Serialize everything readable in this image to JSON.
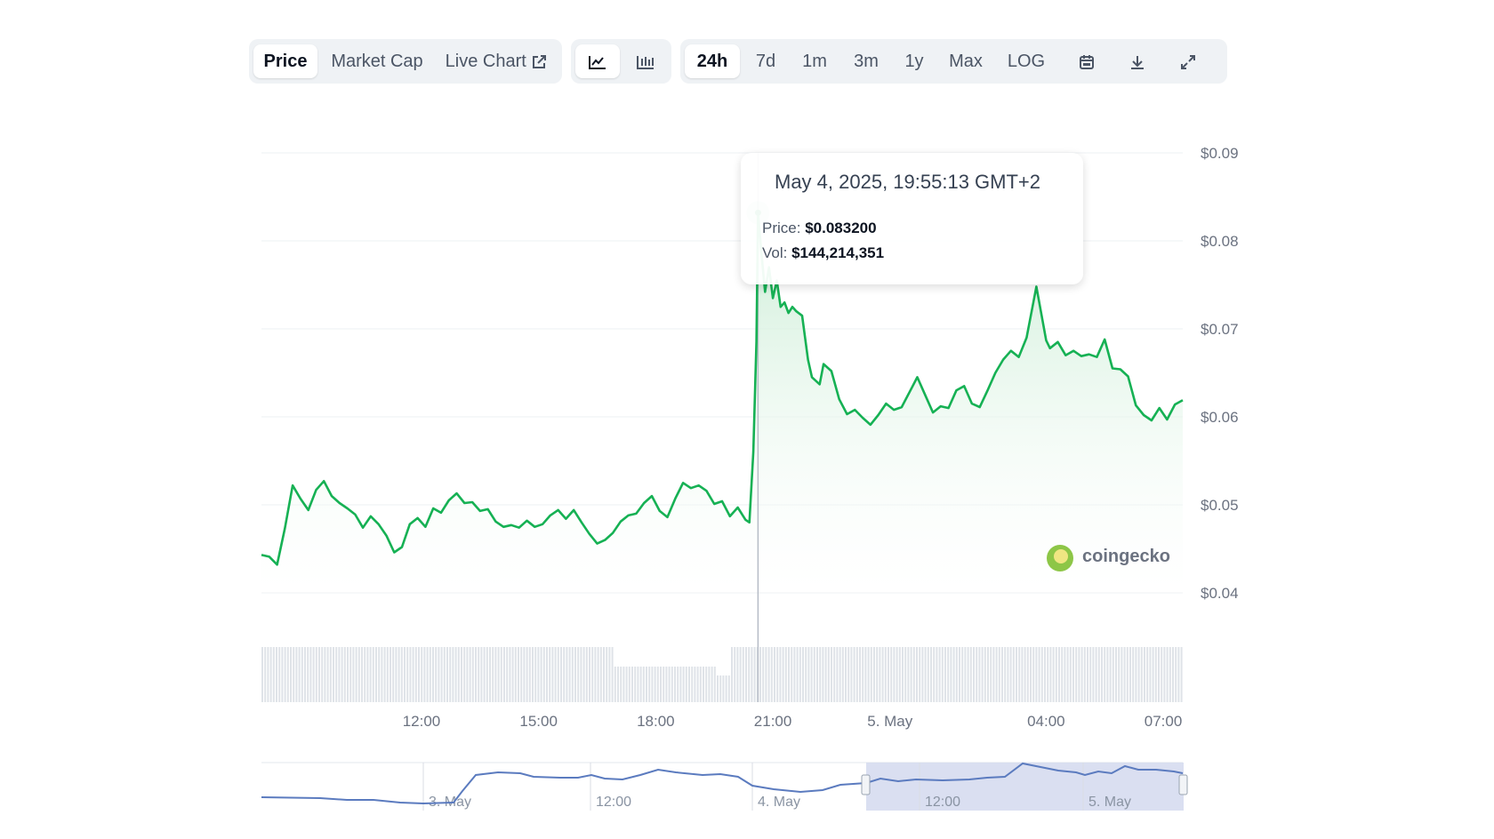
{
  "toolbar": {
    "views": [
      {
        "label": "Price",
        "active": true
      },
      {
        "label": "Market Cap",
        "active": false
      },
      {
        "label": "Live Chart",
        "active": false
      }
    ],
    "chart_types": [
      "line-chart-icon",
      "candlestick-chart-icon"
    ],
    "ranges": [
      {
        "label": "24h",
        "active": true
      },
      {
        "label": "7d",
        "active": false
      },
      {
        "label": "1m",
        "active": false
      },
      {
        "label": "3m",
        "active": false
      },
      {
        "label": "1y",
        "active": false
      },
      {
        "label": "Max",
        "active": false
      },
      {
        "label": "LOG",
        "active": false
      }
    ],
    "tools": [
      "calendar-icon",
      "download-icon",
      "fullscreen-icon"
    ]
  },
  "tooltip": {
    "date": "May 4, 2025, 19:55:13 GMT+2",
    "price_label": "Price:",
    "price_value": "$0.083200",
    "vol_label": "Vol:",
    "vol_value": "$144,214,351"
  },
  "brand": "coingecko",
  "colors": {
    "line": "#16b154",
    "area_top": "#c8ecd3",
    "volume": "#dfe3e8",
    "navigator_line": "#5b7bbf",
    "navigator_selection": "#d6dcef"
  },
  "chart_data": {
    "type": "line",
    "y_ticks": [
      "$0.09",
      "$0.08",
      "$0.07",
      "$0.06",
      "$0.05",
      "$0.04"
    ],
    "y_tick_values": [
      0.09,
      0.08,
      0.07,
      0.06,
      0.05,
      0.04
    ],
    "ylim": [
      0.04,
      0.09
    ],
    "x_ticks": [
      "12:00",
      "15:00",
      "18:00",
      "21:00",
      "5. May",
      "04:00",
      "07:00"
    ],
    "x_tick_hours": [
      12,
      15,
      18,
      21,
      24,
      28,
      31
    ],
    "xlim_hours": [
      7.9,
      31.5
    ],
    "series": [
      {
        "points": [
          [
            7.9,
            0.0443
          ],
          [
            8.1,
            0.0441
          ],
          [
            8.3,
            0.0432
          ],
          [
            8.5,
            0.0473
          ],
          [
            8.7,
            0.0522
          ],
          [
            8.9,
            0.0507
          ],
          [
            9.1,
            0.0494
          ],
          [
            9.3,
            0.0517
          ],
          [
            9.5,
            0.0527
          ],
          [
            9.7,
            0.051
          ],
          [
            9.9,
            0.0502
          ],
          [
            10.1,
            0.0496
          ],
          [
            10.3,
            0.0489
          ],
          [
            10.5,
            0.0474
          ],
          [
            10.7,
            0.0487
          ],
          [
            10.9,
            0.0478
          ],
          [
            11.1,
            0.0465
          ],
          [
            11.3,
            0.0446
          ],
          [
            11.5,
            0.0452
          ],
          [
            11.7,
            0.0478
          ],
          [
            11.9,
            0.0485
          ],
          [
            12.1,
            0.0475
          ],
          [
            12.3,
            0.0496
          ],
          [
            12.5,
            0.0491
          ],
          [
            12.7,
            0.0505
          ],
          [
            12.9,
            0.0513
          ],
          [
            13.1,
            0.0502
          ],
          [
            13.3,
            0.0503
          ],
          [
            13.5,
            0.0493
          ],
          [
            13.7,
            0.0495
          ],
          [
            13.9,
            0.0481
          ],
          [
            14.1,
            0.0475
          ],
          [
            14.3,
            0.0477
          ],
          [
            14.5,
            0.0474
          ],
          [
            14.7,
            0.0482
          ],
          [
            14.9,
            0.0475
          ],
          [
            15.1,
            0.0478
          ],
          [
            15.3,
            0.0488
          ],
          [
            15.5,
            0.0494
          ],
          [
            15.7,
            0.0484
          ],
          [
            15.9,
            0.0494
          ],
          [
            16.1,
            0.048
          ],
          [
            16.3,
            0.0467
          ],
          [
            16.5,
            0.0456
          ],
          [
            16.7,
            0.046
          ],
          [
            16.9,
            0.0468
          ],
          [
            17.1,
            0.0481
          ],
          [
            17.3,
            0.0488
          ],
          [
            17.5,
            0.049
          ],
          [
            17.7,
            0.0502
          ],
          [
            17.9,
            0.051
          ],
          [
            18.1,
            0.0493
          ],
          [
            18.3,
            0.0486
          ],
          [
            18.5,
            0.0507
          ],
          [
            18.7,
            0.0525
          ],
          [
            18.9,
            0.0519
          ],
          [
            19.1,
            0.0522
          ],
          [
            19.3,
            0.0516
          ],
          [
            19.5,
            0.0501
          ],
          [
            19.7,
            0.0504
          ],
          [
            19.9,
            0.0487
          ],
          [
            20.1,
            0.0497
          ],
          [
            20.3,
            0.0483
          ],
          [
            20.4,
            0.048
          ],
          [
            20.5,
            0.056
          ],
          [
            20.58,
            0.0685
          ],
          [
            20.62,
            0.0832
          ],
          [
            20.7,
            0.079
          ],
          [
            20.8,
            0.0742
          ],
          [
            20.9,
            0.077
          ],
          [
            21.0,
            0.0735
          ],
          [
            21.1,
            0.0755
          ],
          [
            21.2,
            0.0725
          ],
          [
            21.3,
            0.073
          ],
          [
            21.4,
            0.0718
          ],
          [
            21.5,
            0.0725
          ],
          [
            21.6,
            0.072
          ],
          [
            21.75,
            0.0715
          ],
          [
            21.9,
            0.0665
          ],
          [
            22.0,
            0.0645
          ],
          [
            22.2,
            0.0637
          ],
          [
            22.3,
            0.066
          ],
          [
            22.5,
            0.0652
          ],
          [
            22.7,
            0.062
          ],
          [
            22.9,
            0.0603
          ],
          [
            23.1,
            0.0608
          ],
          [
            23.3,
            0.0599
          ],
          [
            23.5,
            0.0591
          ],
          [
            23.7,
            0.0602
          ],
          [
            23.9,
            0.0615
          ],
          [
            24.1,
            0.0608
          ],
          [
            24.3,
            0.0611
          ],
          [
            24.5,
            0.0628
          ],
          [
            24.7,
            0.0645
          ],
          [
            24.9,
            0.0625
          ],
          [
            25.1,
            0.0605
          ],
          [
            25.3,
            0.0612
          ],
          [
            25.5,
            0.061
          ],
          [
            25.7,
            0.063
          ],
          [
            25.9,
            0.0635
          ],
          [
            26.1,
            0.0615
          ],
          [
            26.3,
            0.0611
          ],
          [
            26.5,
            0.063
          ],
          [
            26.7,
            0.065
          ],
          [
            26.9,
            0.0665
          ],
          [
            27.1,
            0.0675
          ],
          [
            27.3,
            0.0668
          ],
          [
            27.5,
            0.069
          ],
          [
            27.75,
            0.0748
          ],
          [
            28.0,
            0.0687
          ],
          [
            28.1,
            0.0678
          ],
          [
            28.3,
            0.0685
          ],
          [
            28.5,
            0.067
          ],
          [
            28.7,
            0.0675
          ],
          [
            28.9,
            0.0669
          ],
          [
            29.1,
            0.0671
          ],
          [
            29.3,
            0.0668
          ],
          [
            29.5,
            0.0688
          ],
          [
            29.7,
            0.0655
          ],
          [
            29.9,
            0.0654
          ],
          [
            30.1,
            0.0646
          ],
          [
            30.3,
            0.0613
          ],
          [
            30.5,
            0.0602
          ],
          [
            30.7,
            0.0596
          ],
          [
            30.9,
            0.061
          ],
          [
            31.1,
            0.0597
          ],
          [
            31.3,
            0.0614
          ],
          [
            31.5,
            0.0619
          ]
        ]
      }
    ],
    "highlight": {
      "hour": 20.62,
      "value": 0.0832
    },
    "navigator": {
      "x_ticks": [
        "3. May",
        "12:00",
        "4. May",
        "12:00",
        "5. May"
      ],
      "selection": "last 24h"
    },
    "grid": true
  }
}
